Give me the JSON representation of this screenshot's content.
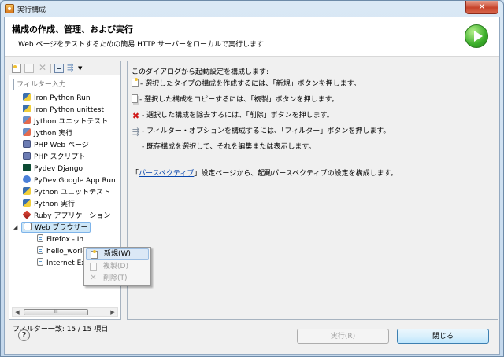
{
  "window": {
    "title": "実行構成",
    "close_label": "✕"
  },
  "header": {
    "title": "構成の作成、管理、および実行",
    "description": "Web ページをテストするための簡易 HTTP サーバーをローカルで実行します"
  },
  "left_panel": {
    "filter_placeholder": "フィルター入力",
    "tree": [
      {
        "label": "Iron Python Run",
        "icon": "python-icon"
      },
      {
        "label": "Iron Python unittest",
        "icon": "python-icon"
      },
      {
        "label": "Jython ユニットテスト",
        "icon": "jython-icon"
      },
      {
        "label": "Jython 実行",
        "icon": "jython-icon"
      },
      {
        "label": "PHP Web ページ",
        "icon": "php-icon"
      },
      {
        "label": "PHP スクリプト",
        "icon": "php-icon"
      },
      {
        "label": "Pydev Django",
        "icon": "django-icon"
      },
      {
        "label": "PyDev Google App Run",
        "icon": "google-app-icon"
      },
      {
        "label": "Python ユニットテスト",
        "icon": "python-icon"
      },
      {
        "label": "Python 実行",
        "icon": "python-icon"
      },
      {
        "label": "Ruby アプリケーション",
        "icon": "ruby-icon"
      },
      {
        "label": "Web ブラウザー",
        "icon": "web-browser-icon"
      },
      {
        "label": "Firefox - In",
        "icon": "document-icon"
      },
      {
        "label": "hello_world",
        "icon": "document-icon"
      },
      {
        "label": "Internet Ex",
        "icon": "document-icon"
      }
    ],
    "scroll_thumb_label": "III",
    "filter_status": "フィルター一致: 15 / 15 項目"
  },
  "right_panel": {
    "intro": "このダイアログから起動設定を構成します:",
    "lines": [
      "- 選択したタイプの構成を作成するには、「新規」ボタンを押します。",
      "- 選択した構成をコピーするには、「複製」ボタンを押します。",
      "- 選択した構成を除去するには、「削除」ボタンを押します。",
      "- フィルター・オプションを構成するには、「フィルター」ボタンを押します。",
      "- 既存構成を選択して、それを編集または表示します。"
    ],
    "link_prefix": "「",
    "link_text": "パースペクティブ",
    "link_suffix": "」設定ページから、起動パースペクティブの設定を構成します。"
  },
  "context_menu": {
    "items": [
      {
        "label": "新規(W)",
        "enabled": true
      },
      {
        "label": "複製(D)",
        "enabled": false
      },
      {
        "label": "削除(T)",
        "enabled": false
      }
    ]
  },
  "buttons": {
    "help": "?",
    "run": "実行(R)",
    "close": "閉じる"
  }
}
